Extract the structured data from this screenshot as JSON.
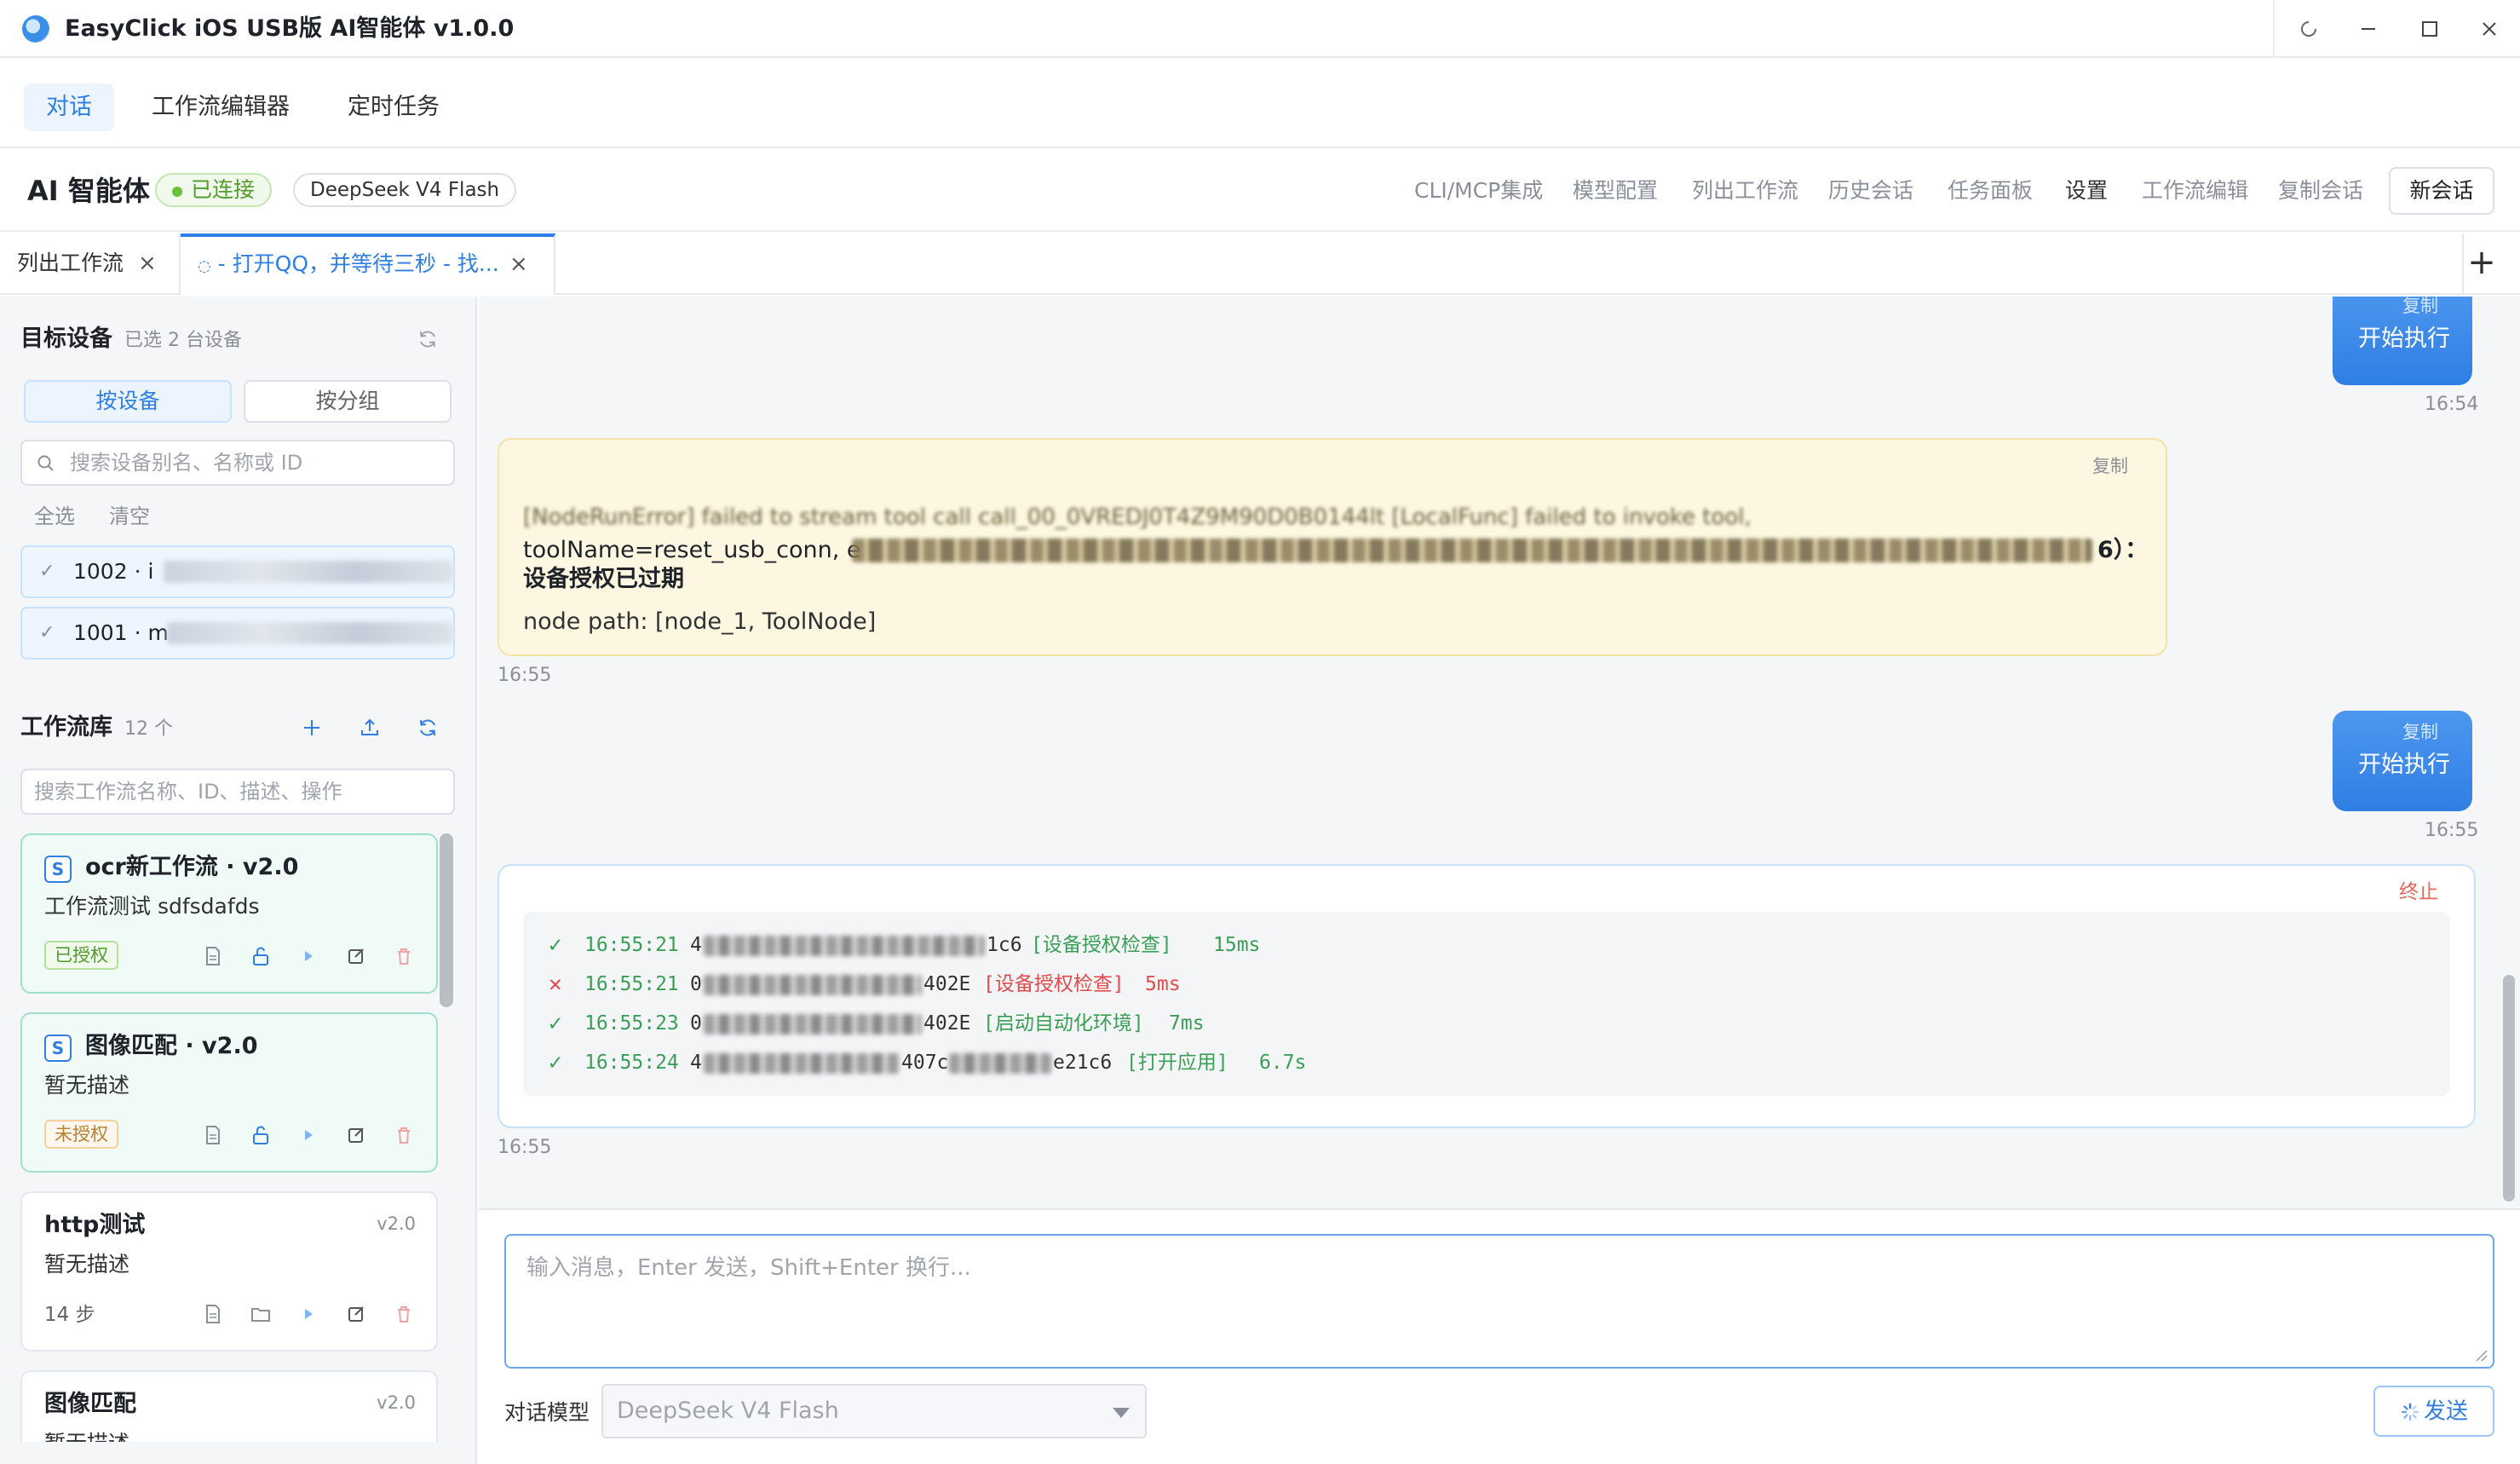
{
  "window": {
    "title": "EasyClick iOS USB版 AI智能体 v1.0.0",
    "controls": [
      "spinner-icon",
      "minimize-icon",
      "maximize-icon",
      "close-icon"
    ]
  },
  "nav": {
    "tabs": [
      {
        "label": "对话",
        "active": true
      },
      {
        "label": "工作流编辑器",
        "active": false
      },
      {
        "label": "定时任务",
        "active": false
      }
    ]
  },
  "toolbar": {
    "title": "AI 智能体",
    "status": "已连接",
    "model": "DeepSeek V4 Flash",
    "links": [
      "CLI/MCP集成",
      "模型配置",
      "列出工作流",
      "历史会话",
      "任务面板",
      "设置",
      "工作流编辑",
      "复制会话"
    ],
    "new_session": "新会话"
  },
  "session_tabs": [
    {
      "label": "列出工作流",
      "active": false
    },
    {
      "label": "- 打开QQ，并等待三秒 - 找...",
      "active": true
    }
  ],
  "sidebar": {
    "devices": {
      "title": "目标设备",
      "selected_count": "已选 2 台设备",
      "segments": [
        "按设备",
        "按分组"
      ],
      "search_placeholder": "搜索设备别名、名称或 ID",
      "select_all": "全选",
      "clear": "清空",
      "items": [
        {
          "label": "1002 · i",
          "checked": true
        },
        {
          "label": "1001 · m",
          "checked": true
        }
      ]
    },
    "workflows": {
      "title": "工作流库",
      "count": "12 个",
      "search_placeholder": "搜索工作流名称、ID、描述、操作",
      "items": [
        {
          "badge": "S",
          "title": "ocr新工作流 · v2.0",
          "desc": "工作流测试 sdfsdafds",
          "tag": "已授权",
          "tag_status": "authorized"
        },
        {
          "badge": "S",
          "title": "图像匹配 · v2.0",
          "desc": "暂无描述",
          "tag": "未授权",
          "tag_status": "unauthorized"
        },
        {
          "title": "http测试",
          "version": "v2.0",
          "desc": "暂无描述",
          "steps": "14 步"
        },
        {
          "title": "图像匹配",
          "version": "v2.0",
          "desc": "暂无描述"
        }
      ]
    }
  },
  "chat": {
    "messages": [
      {
        "role": "user",
        "text": "开始执行",
        "copy": "复制",
        "time": "16:54"
      },
      {
        "role": "assistant-error",
        "copy": "复制",
        "line1": "[NodeRunError] failed to stream tool call call_00_0VREDJ0T4Z9M90D0B0144lt [LocalFunc] failed to invoke tool,",
        "line2_start": "toolName=reset_usb_conn, e",
        "line2_end": "6）：",
        "line3": "设备授权已过期",
        "line4": "node path: [node_1, ToolNode]",
        "time": "16:55"
      },
      {
        "role": "user",
        "text": "开始执行",
        "copy": "复制",
        "time": "16:55"
      },
      {
        "role": "exec-log",
        "stop": "终止",
        "time": "16:55",
        "rows": [
          {
            "status": "ok",
            "time": "16:55:21",
            "id_start": "4",
            "id_end": "1c6",
            "action": "[设备授权检查]",
            "duration": "15ms"
          },
          {
            "status": "error",
            "time": "16:55:21",
            "id_start": "0",
            "id_end": "402E",
            "action": "[设备授权检查]",
            "duration": "5ms"
          },
          {
            "status": "ok",
            "time": "16:55:23",
            "id_start": "0",
            "id_end": "402E",
            "action": "[启动自动化环境]",
            "duration": "7ms"
          },
          {
            "status": "ok",
            "time": "16:55:24",
            "id_start": "4",
            "id_mid": "407c",
            "id_end": "e21c6",
            "action": "[打开应用]",
            "duration": "6.7s"
          }
        ]
      }
    ]
  },
  "composer": {
    "placeholder": "输入消息，Enter 发送，Shift+Enter 换行...",
    "model_label": "对话模型",
    "model_value": "DeepSeek V4 Flash",
    "send": "发送"
  },
  "colors": {
    "accent": "#2f7ee3",
    "success": "#67c23a",
    "error": "#e04b4b",
    "warning_bg": "#fdf7e1"
  }
}
